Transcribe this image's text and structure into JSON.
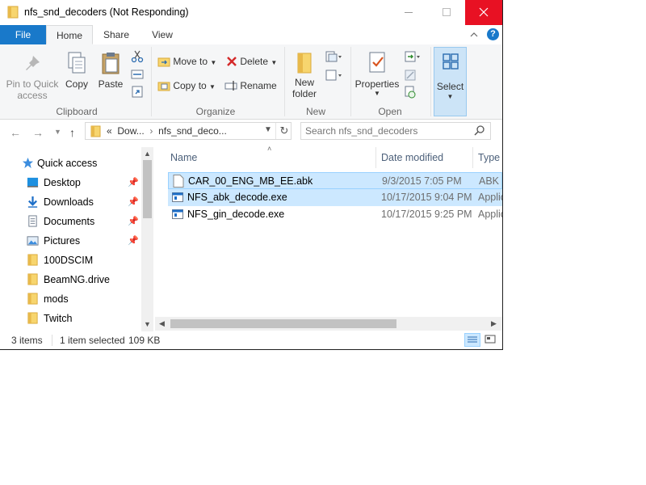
{
  "window": {
    "title": "nfs_snd_decoders (Not Responding)"
  },
  "ribbon": {
    "tabs": [
      {
        "label": "File"
      },
      {
        "label": "Home"
      },
      {
        "label": "Share"
      },
      {
        "label": "View"
      }
    ],
    "clipboard": {
      "pin_label_1": "Pin to Quick",
      "pin_label_2": "access",
      "copy": "Copy",
      "paste": "Paste",
      "group": "Clipboard"
    },
    "organize": {
      "move_to": "Move to",
      "copy_to": "Copy to",
      "delete": "Delete",
      "rename": "Rename",
      "group": "Organize"
    },
    "new": {
      "new_folder_1": "New",
      "new_folder_2": "folder",
      "group": "New"
    },
    "open": {
      "properties": "Properties",
      "group": "Open"
    },
    "select": {
      "label": "Select"
    }
  },
  "address": {
    "overflow": "«",
    "crumb_1": "Dow...",
    "crumb_2": "nfs_snd_deco...",
    "search_placeholder": "Search nfs_snd_decoders"
  },
  "nav": {
    "items": [
      {
        "label": "Quick access",
        "icon": "star-icon"
      },
      {
        "label": "Desktop",
        "icon": "desktop-icon",
        "pinned": true
      },
      {
        "label": "Downloads",
        "icon": "download-icon",
        "pinned": true
      },
      {
        "label": "Documents",
        "icon": "documents-icon",
        "pinned": true
      },
      {
        "label": "Pictures",
        "icon": "pictures-icon",
        "pinned": true
      },
      {
        "label": "100DSCIM",
        "icon": "folder-icon"
      },
      {
        "label": "BeamNG.drive",
        "icon": "folder-icon"
      },
      {
        "label": "mods",
        "icon": "folder-icon"
      },
      {
        "label": "Twitch",
        "icon": "folder-icon"
      }
    ]
  },
  "list": {
    "columns": {
      "name": "Name",
      "date": "Date modified",
      "type": "Type"
    },
    "rows": [
      {
        "name": "CAR_00_ENG_MB_EE.abk",
        "date": "9/3/2015 7:05 PM",
        "type": "ABK F"
      },
      {
        "name": "NFS_abk_decode.exe",
        "date": "10/17/2015 9:04 PM",
        "type": "Applic"
      },
      {
        "name": "NFS_gin_decode.exe",
        "date": "10/17/2015 9:25 PM",
        "type": "Applic"
      }
    ]
  },
  "status": {
    "count": "3 items",
    "selection": "1 item selected",
    "size": "109 KB"
  },
  "colors": {
    "accent": "#1979ca",
    "close": "#e81123",
    "selection": "#cce8ff"
  }
}
